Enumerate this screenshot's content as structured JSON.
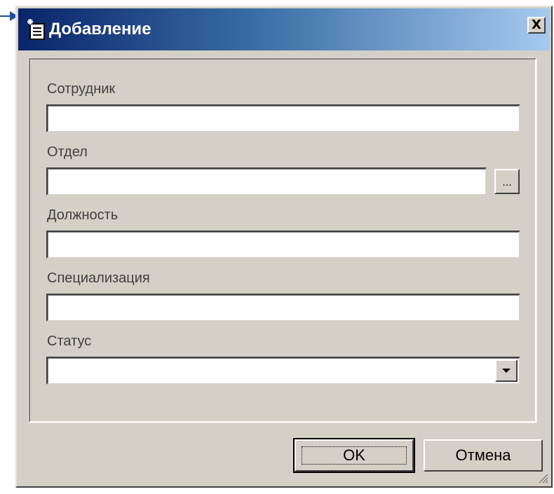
{
  "window": {
    "title": "Добавление",
    "close_label": "X"
  },
  "fields": {
    "employee": {
      "label": "Сотрудник",
      "value": ""
    },
    "department": {
      "label": "Отдел",
      "value": "",
      "browse_label": "..."
    },
    "position": {
      "label": "Должность",
      "value": ""
    },
    "specialization": {
      "label": "Специализация",
      "value": ""
    },
    "status": {
      "label": "Статус",
      "value": ""
    }
  },
  "buttons": {
    "ok_label": "OK",
    "cancel_label": "Отмена"
  },
  "icons": {
    "title": "new-document-icon",
    "close": "close-icon",
    "combo": "chevron-down-icon",
    "grip": "resize-grip-icon"
  },
  "colors": {
    "titlebar_start": "#0a246a",
    "titlebar_end": "#a6caf0",
    "dialog_face": "#d4d0c8"
  }
}
